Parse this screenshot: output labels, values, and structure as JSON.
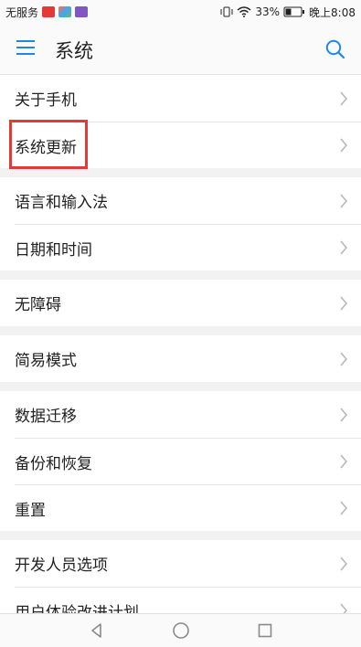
{
  "status_bar": {
    "carrier": "无服务",
    "battery": "33%",
    "time": "晚上8:08"
  },
  "header": {
    "title": "系统"
  },
  "groups": [
    {
      "items": [
        {
          "label": "关于手机"
        },
        {
          "label": "系统更新"
        }
      ]
    },
    {
      "items": [
        {
          "label": "语言和输入法"
        },
        {
          "label": "日期和时间"
        }
      ]
    },
    {
      "items": [
        {
          "label": "无障碍"
        }
      ]
    },
    {
      "items": [
        {
          "label": "简易模式"
        }
      ]
    },
    {
      "items": [
        {
          "label": "数据迁移"
        },
        {
          "label": "备份和恢复"
        },
        {
          "label": "重置"
        }
      ]
    },
    {
      "items": [
        {
          "label": "开发人员选项"
        },
        {
          "label": "用户体验改进计划"
        }
      ]
    }
  ],
  "colors": {
    "accent": "#1e88e5",
    "highlight": "#e53935"
  },
  "icons": {
    "menu": "hamburger-menu-icon",
    "search": "search-icon",
    "chevron": "chevron-right-icon",
    "back": "back-icon",
    "home": "home-icon",
    "recent": "recent-apps-icon"
  }
}
